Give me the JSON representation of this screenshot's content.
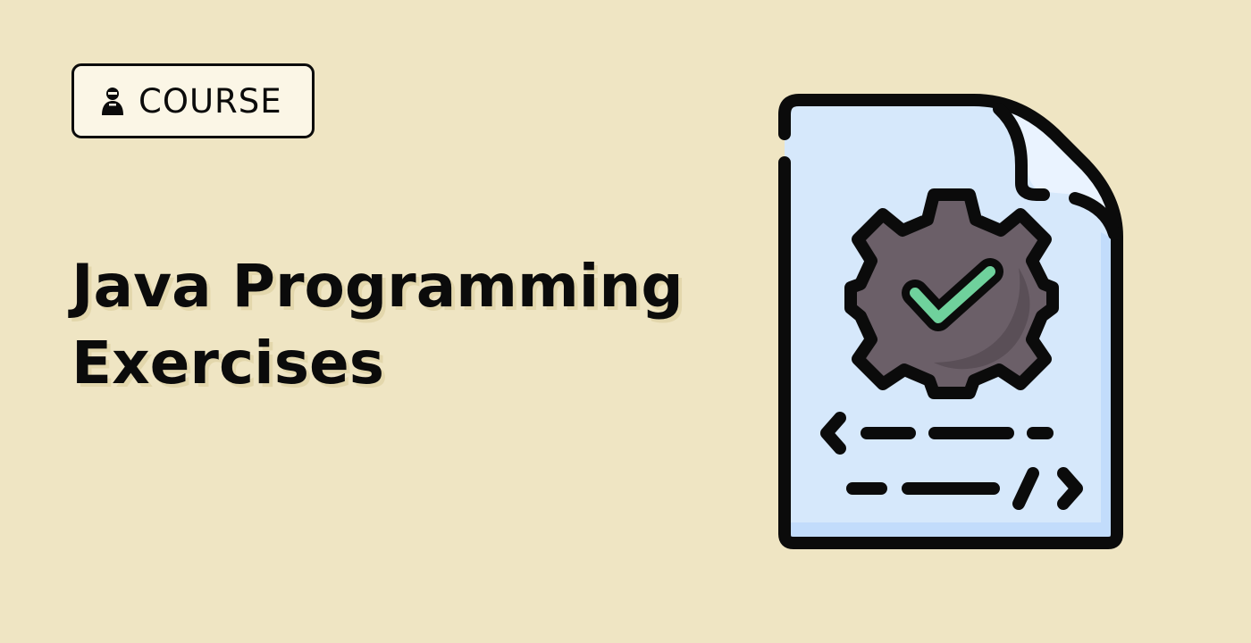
{
  "badge": {
    "label": "COURSE",
    "icon": "student-icon"
  },
  "title": {
    "line1": "Java Programming",
    "line2": "Exercises"
  },
  "illustration": {
    "icon": "code-file-settings-icon"
  },
  "colors": {
    "background": "#efe5c3",
    "badge_fill": "#fbf6e6",
    "outline": "#0b0b0b",
    "page_fill": "#d6e8fb",
    "page_shade": "#c2dcfb",
    "gear": "#6b5f68",
    "check": "#6fd19c"
  }
}
